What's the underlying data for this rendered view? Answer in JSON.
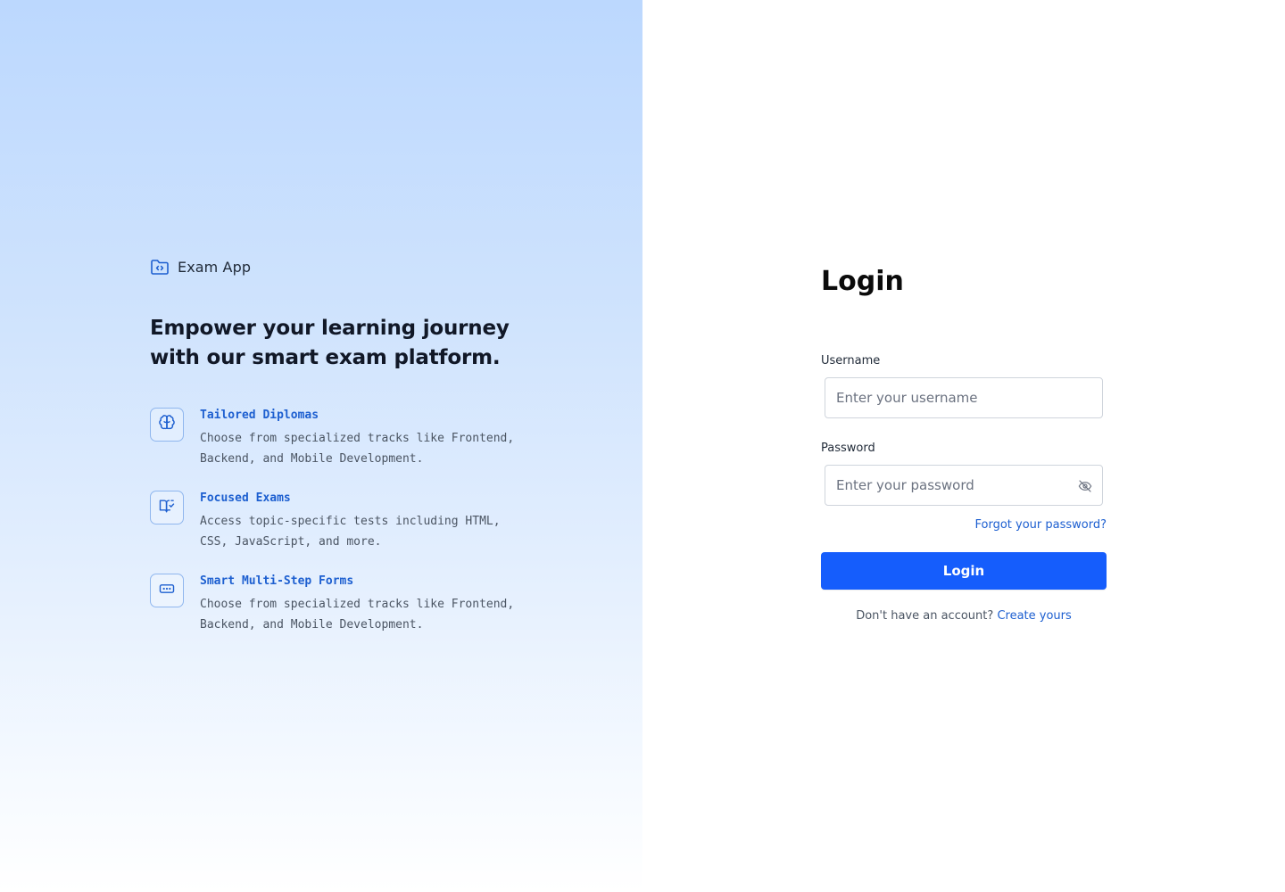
{
  "brand": {
    "name": "Exam App",
    "icon": "folder-code-icon"
  },
  "hero": {
    "headline": "Empower your learning journey with our smart exam platform."
  },
  "features": [
    {
      "icon": "brain-icon",
      "title": "Tailored Diplomas",
      "description": "Choose from specialized tracks like Frontend, Backend, and Mobile Development."
    },
    {
      "icon": "book-check-icon",
      "title": "Focused Exams",
      "description": "Access topic-specific tests including HTML, CSS, JavaScript, and more."
    },
    {
      "icon": "form-input-icon",
      "title": "Smart Multi-Step Forms",
      "description": "Choose from specialized tracks like Frontend, Backend, and Mobile Development."
    }
  ],
  "login": {
    "title": "Login",
    "username_label": "Username",
    "username_value": "",
    "username_placeholder": "Enter your username",
    "password_label": "Password",
    "password_value": "",
    "password_placeholder": "Enter your password",
    "password_toggle_icon": "eye-off-icon",
    "forgot_link": "Forgot your password?",
    "submit_label": "Login",
    "signup_prompt": "Don't have an account?",
    "signup_link": "Create yours"
  },
  "colors": {
    "accent": "#155dfc",
    "link": "#1d5fd0",
    "feature_title": "#1d5fd0",
    "gradient_top": "#bcd8fe",
    "gradient_bottom": "#ffffff"
  }
}
